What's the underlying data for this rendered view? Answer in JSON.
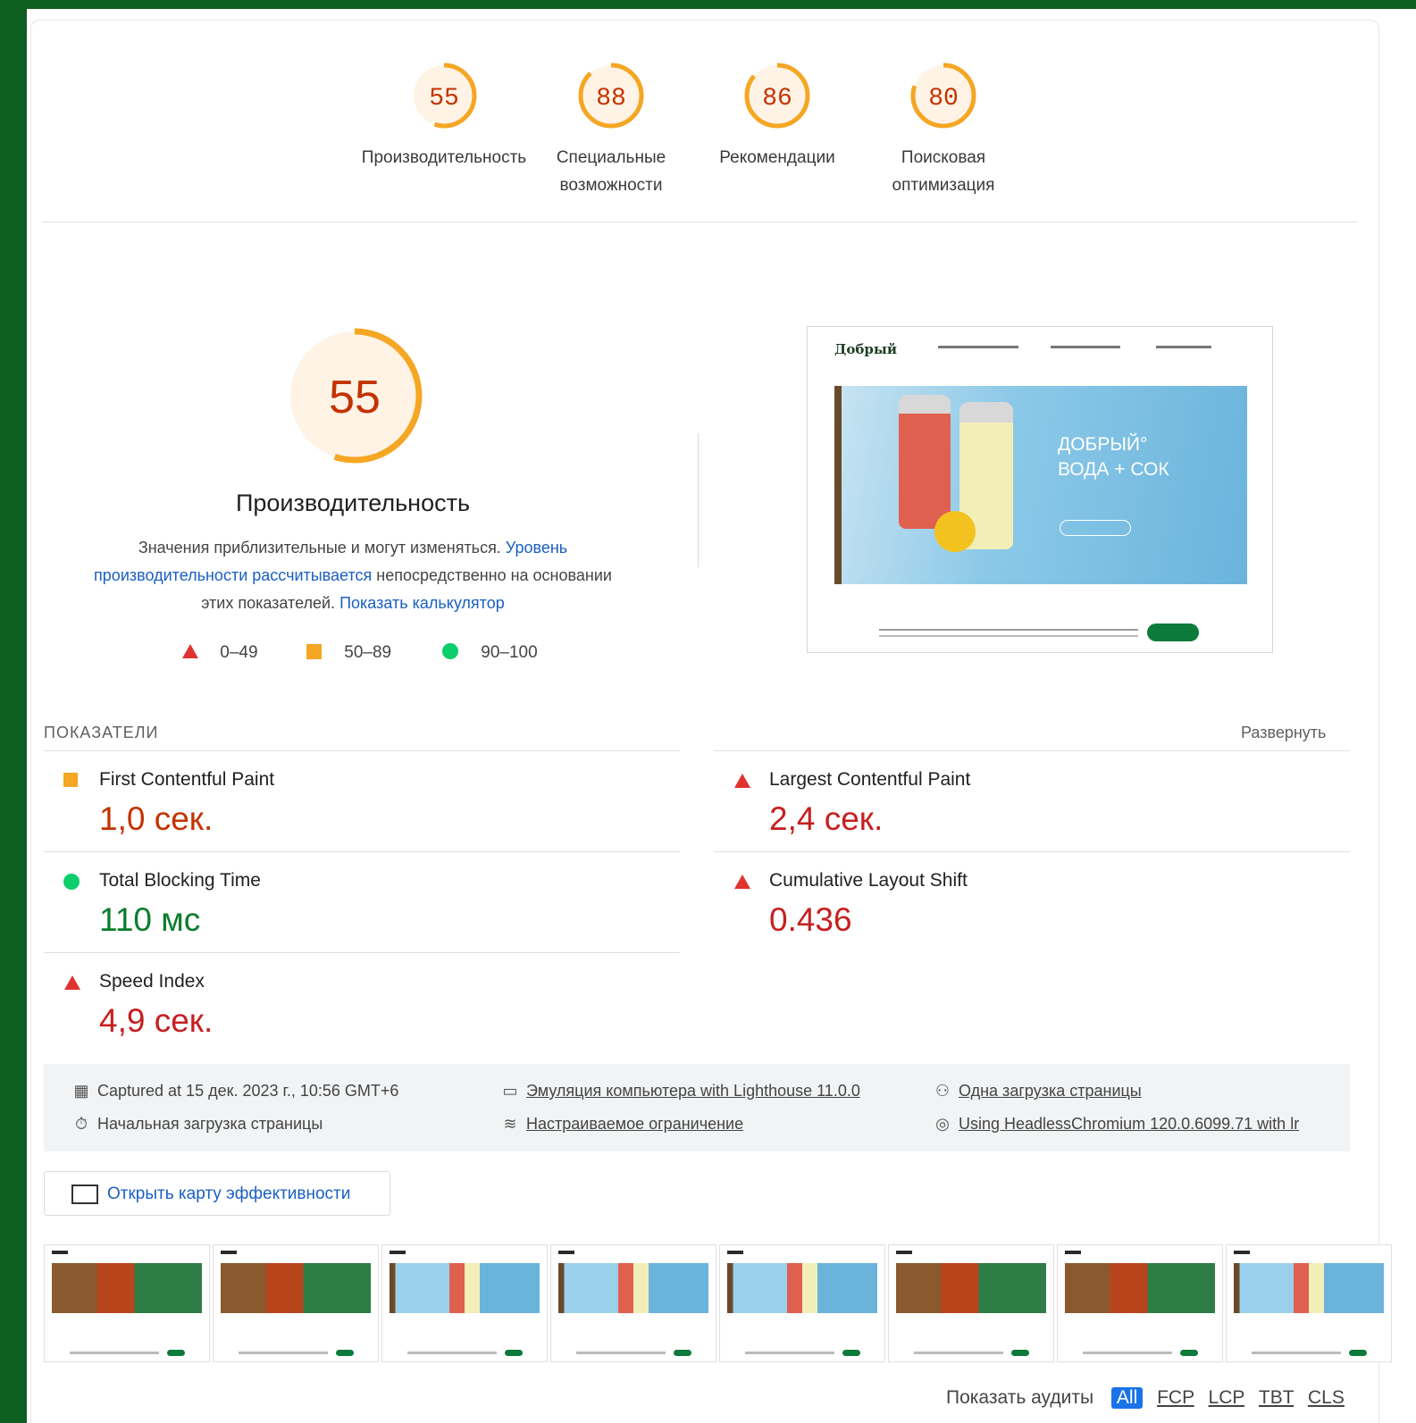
{
  "gauges": [
    {
      "score": "55",
      "label_line1": "Производительность",
      "label_line2": ""
    },
    {
      "score": "88",
      "label_line1": "Специальные",
      "label_line2": "возможности"
    },
    {
      "score": "86",
      "label_line1": "Рекомендации",
      "label_line2": ""
    },
    {
      "score": "80",
      "label_line1": "Поисковая",
      "label_line2": "оптимизация"
    }
  ],
  "performance": {
    "score": "55",
    "title": "Производительность",
    "desc_part1": "Значения приблизительные и могут изменяться. ",
    "desc_link1": "Уровень производительности рассчитывается",
    "desc_part2": " непосредственно на основании этих показателей. ",
    "desc_link2": "Показать калькулятор"
  },
  "legend": [
    {
      "range": "0–49"
    },
    {
      "range": "50–89"
    },
    {
      "range": "90–100"
    }
  ],
  "screenshot": {
    "logo": "Добрый",
    "hero_line1": "ДОБРЫЙ°",
    "hero_line2": "ВОДА + СОК"
  },
  "metrics_section": {
    "title": "ПОКАЗАТЕЛИ",
    "expand": "Развернуть"
  },
  "metrics": [
    {
      "name": "First Contentful Paint",
      "value": "1,0 сек.",
      "status": "average"
    },
    {
      "name": "Largest Contentful Paint",
      "value": "2,4 сек.",
      "status": "fail"
    },
    {
      "name": "Total Blocking Time",
      "value": "110 мс",
      "status": "pass"
    },
    {
      "name": "Cumulative Layout Shift",
      "value": "0.436",
      "status": "fail"
    },
    {
      "name": "Speed Index",
      "value": "4,9 сек.",
      "status": "fail"
    }
  ],
  "info": {
    "captured": "Captured at 15 дек. 2023 г., 10:56 GMT+6",
    "initial_load": "Начальная загрузка страницы",
    "emulation": "Эмуляция компьютера with Lighthouse 11.0.0",
    "throttling": "Настраиваемое ограничение",
    "single_load": "Одна загрузка страницы",
    "browser": "Using HeadlessChromium 120.0.6099.71 with lr"
  },
  "treemap_button": "Открыть карту эффективности",
  "audits_filter": {
    "label": "Показать аудиты",
    "options": [
      "All",
      "FCP",
      "LCP",
      "TBT",
      "CLS"
    ],
    "selected": "All"
  },
  "colors": {
    "frame_green": "#0d5e1f",
    "average_orange": "#f5a623",
    "fail_red": "#e0332f",
    "pass_green": "#0cce6b",
    "link_blue": "#1a5fc4"
  }
}
